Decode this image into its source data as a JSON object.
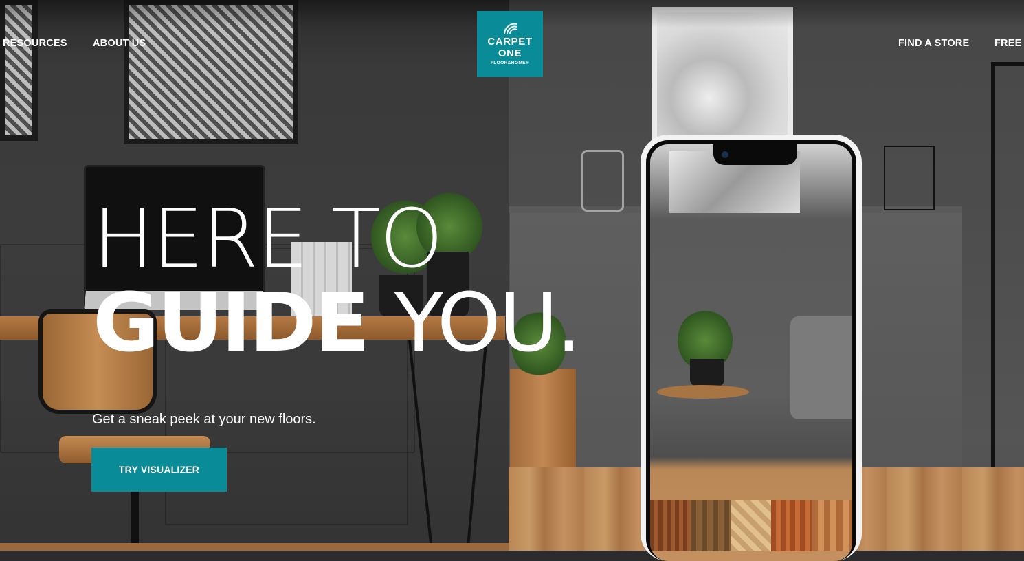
{
  "nav": {
    "left": [
      "RESOURCES",
      "ABOUT US"
    ],
    "right": [
      "FIND A STORE",
      "FREE I"
    ]
  },
  "logo": {
    "line1": "CARPET",
    "line2": "ONE",
    "line3": "FLOOR&HOME®",
    "color": "#0a8c98"
  },
  "hero": {
    "line1": "HERE TO",
    "line2_bold": "GUIDE",
    "line2_thin": "YOU.",
    "subtitle": "Get a sneak peek at your new floors.",
    "cta_label": "TRY VISUALIZER"
  },
  "colors": {
    "accent": "#0a8c98",
    "text": "#ffffff"
  }
}
